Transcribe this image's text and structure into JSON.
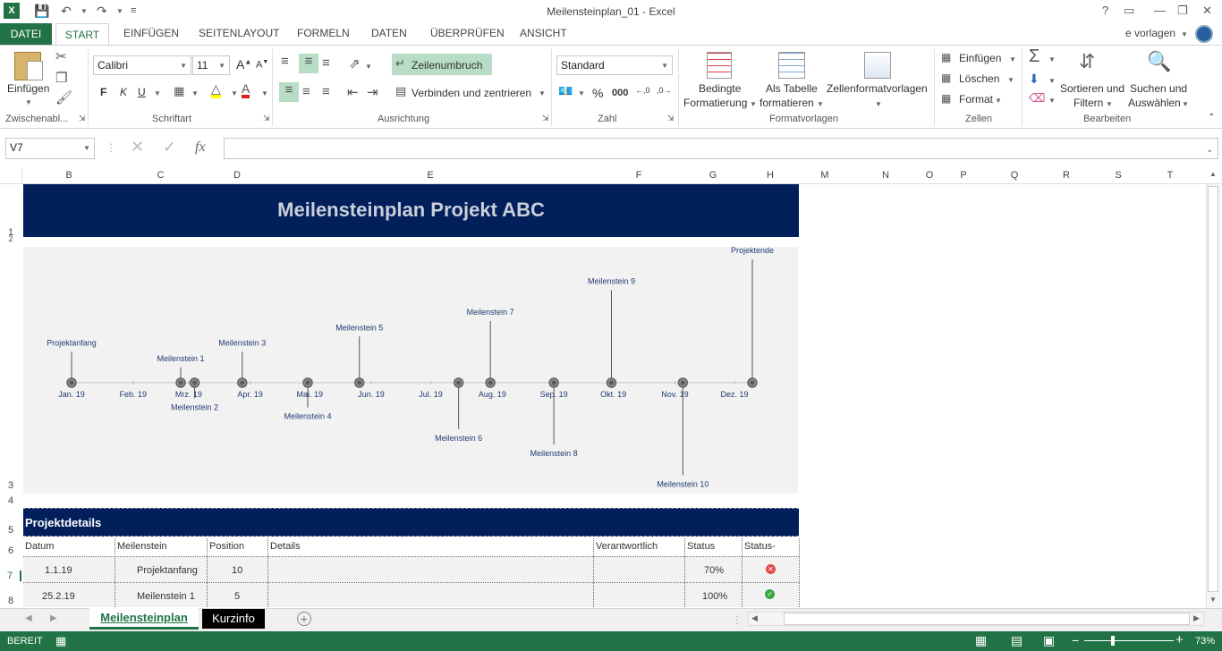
{
  "window": {
    "title": "Meilensteinplan_01 - Excel",
    "help": "?",
    "account": "e vorlagen"
  },
  "tabs": [
    "DATEI",
    "START",
    "EINFÜGEN",
    "SEITENLAYOUT",
    "FORMELN",
    "DATEN",
    "ÜBERPRÜFEN",
    "ANSICHT"
  ],
  "ribbon": {
    "clipboard": {
      "paste": "Einfügen",
      "group": "Zwischenabl..."
    },
    "font": {
      "name": "Calibri",
      "size": "11",
      "bold": "F",
      "italic": "K",
      "underline": "U",
      "group": "Schriftart"
    },
    "alignment": {
      "wrap": "Zeilenumbruch",
      "merge": "Verbinden und zentrieren",
      "group": "Ausrichtung"
    },
    "number": {
      "format": "Standard",
      "percent": "%",
      "thousands": "000",
      "group": "Zahl"
    },
    "styles": {
      "conditional1": "Bedingte",
      "conditional2": "Formatierung",
      "table1": "Als Tabelle",
      "table2": "formatieren",
      "cellstyles": "Zellenformatvorlagen",
      "group": "Formatvorlagen"
    },
    "cells": {
      "insert": "Einfügen",
      "delete": "Löschen",
      "format": "Format",
      "group": "Zellen"
    },
    "editing": {
      "sort1": "Sortieren und",
      "sort2": "Filtern",
      "find1": "Suchen und",
      "find2": "Auswählen",
      "group": "Bearbeiten"
    }
  },
  "formula_bar": {
    "name_box": "V7",
    "fx": "fx",
    "value": ""
  },
  "columns": [
    "B",
    "C",
    "D",
    "E",
    "F",
    "G",
    "H",
    "M",
    "N",
    "O",
    "P",
    "Q",
    "R",
    "S",
    "T"
  ],
  "rows": [
    "1",
    "2",
    "3",
    "4",
    "5",
    "6",
    "7",
    "8"
  ],
  "sheet": {
    "title": "Meilensteinplan Projekt ABC",
    "section": "Projektdetails",
    "headers": [
      "Datum",
      "Meilenstein",
      "Position",
      "Details",
      "Verantwortlich",
      "Status",
      "Status-"
    ],
    "rows": [
      {
        "datum": "1.1.19",
        "meilenstein": "Projektanfang",
        "position": "10",
        "details": "",
        "verantwortlich": "",
        "status": "70%",
        "icon": "error-x-icon"
      },
      {
        "datum": "25.2.19",
        "meilenstein": "Meilenstein 1",
        "position": "5",
        "details": "",
        "verantwortlich": "",
        "status": "100%",
        "icon": "check-icon"
      }
    ]
  },
  "chart_data": {
    "type": "scatter",
    "x_axis_labels": [
      "Jan. 19",
      "Feb. 19",
      "Mrz. 19",
      "Apr. 19",
      "Mai. 19",
      "Jun. 19",
      "Jul. 19",
      "Aug. 19",
      "Sep. 19",
      "Okt. 19",
      "Nov. 19",
      "Dez. 19"
    ],
    "milestones": [
      {
        "label": "Projektanfang",
        "date": "2019-01-01",
        "position": 10
      },
      {
        "label": "Meilenstein 1",
        "date": "2019-02-25",
        "position": 5
      },
      {
        "label": "Meilenstein 2",
        "date": "2019-03-04",
        "position": -5
      },
      {
        "label": "Meilenstein 3",
        "date": "2019-03-28",
        "position": 10
      },
      {
        "label": "Meilenstein 4",
        "date": "2019-04-30",
        "position": -8
      },
      {
        "label": "Meilenstein 5",
        "date": "2019-05-26",
        "position": 15
      },
      {
        "label": "Meilenstein 6",
        "date": "2019-07-15",
        "position": -15
      },
      {
        "label": "Meilenstein 7",
        "date": "2019-07-31",
        "position": 20
      },
      {
        "label": "Meilenstein 8",
        "date": "2019-09-01",
        "position": -20
      },
      {
        "label": "Meilenstein 9",
        "date": "2019-09-30",
        "position": 30
      },
      {
        "label": "Meilenstein 10",
        "date": "2019-11-05",
        "position": -30
      },
      {
        "label": "Projektende",
        "date": "2019-12-10",
        "position": 40
      }
    ]
  },
  "sheet_tabs": [
    "Meilensteinplan",
    "Kurzinfo"
  ],
  "status": {
    "ready": "BEREIT",
    "zoom": "73%"
  },
  "colors": {
    "excel_green": "#217346",
    "banner": "#001f5b",
    "milestone_text": "#1f3b73"
  }
}
